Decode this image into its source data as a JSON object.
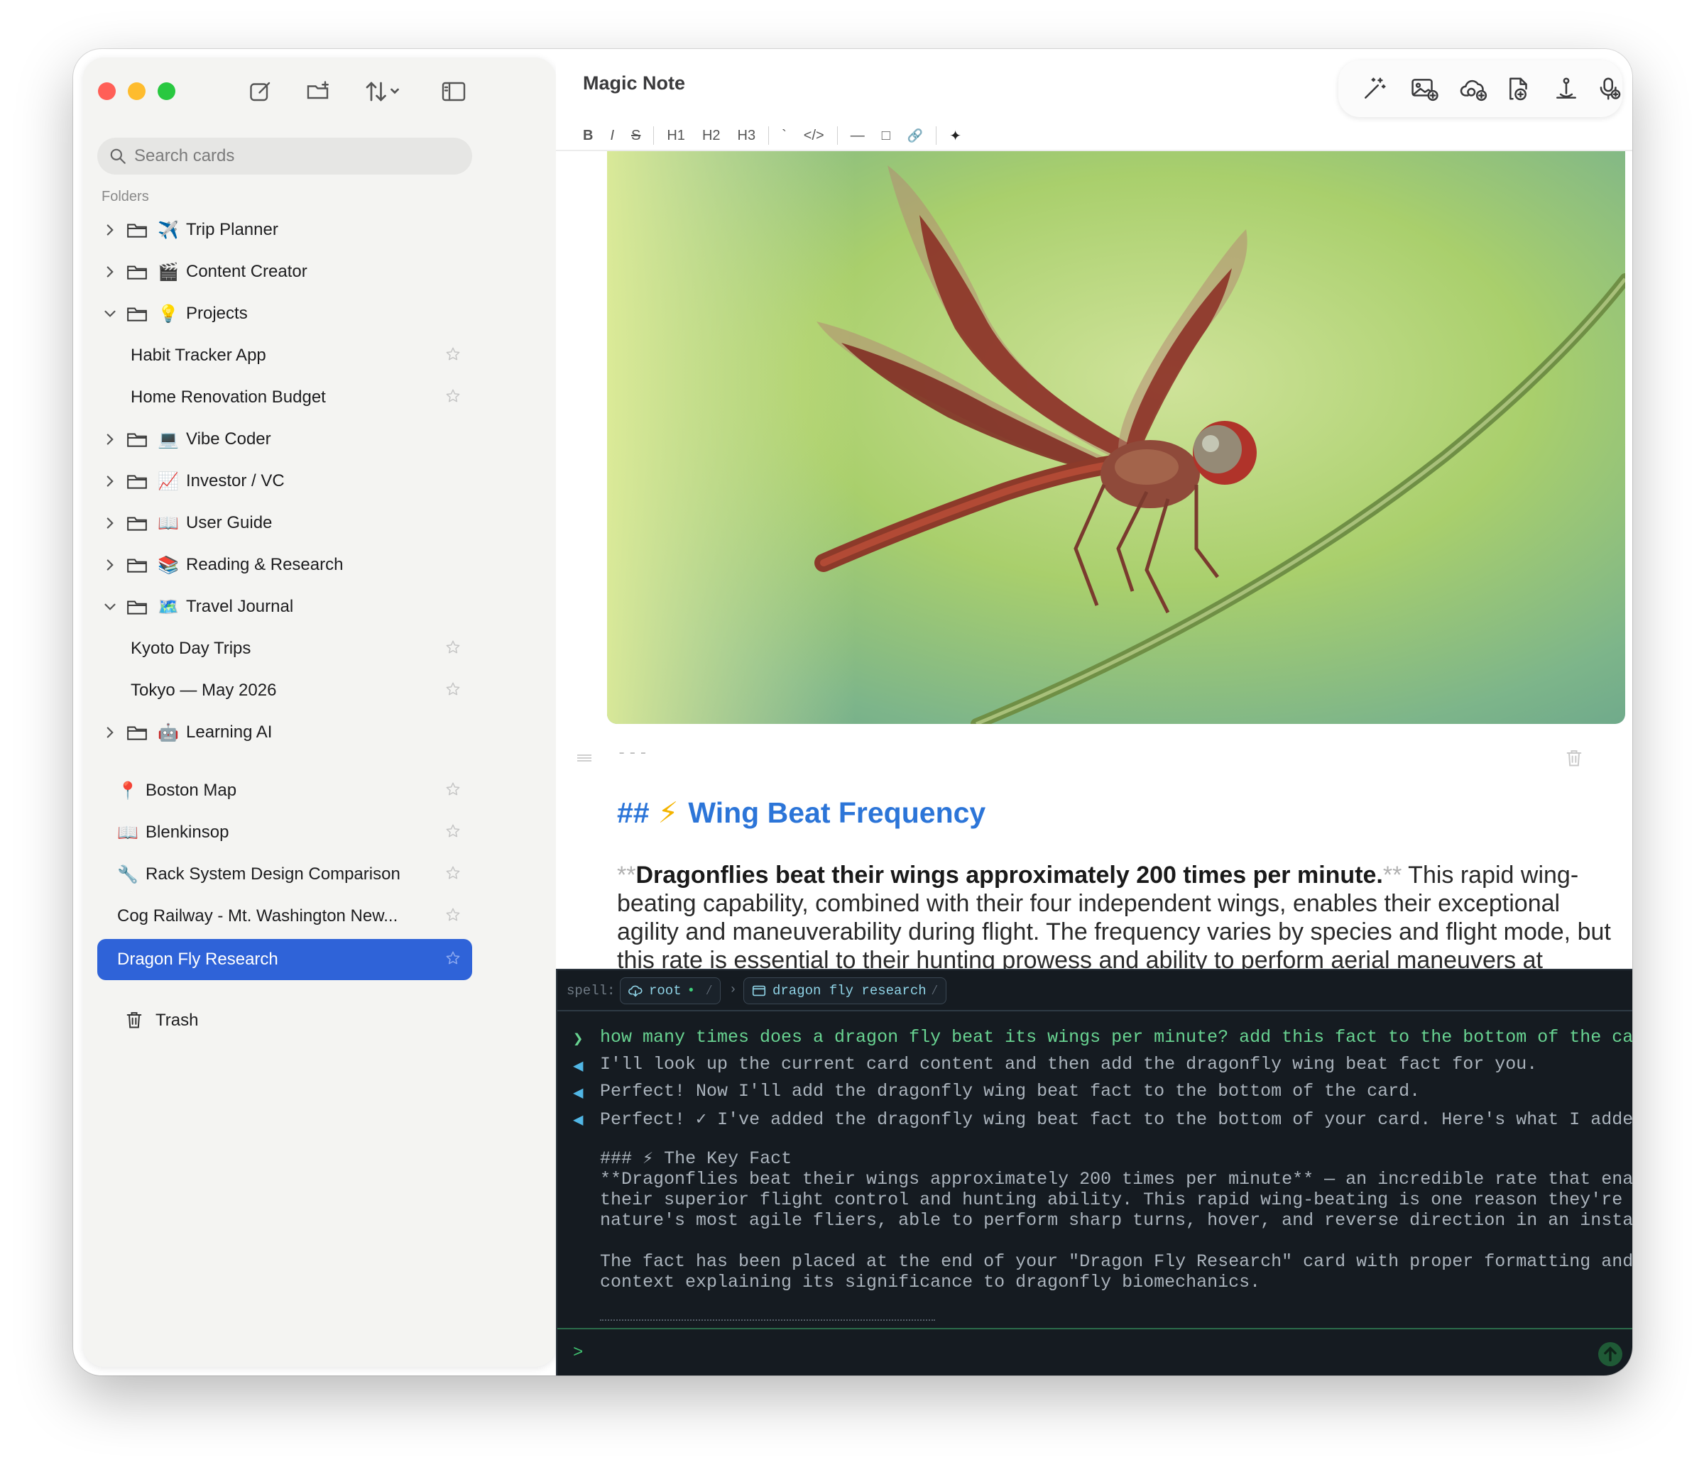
{
  "app": {
    "title": "Magic Note"
  },
  "search": {
    "placeholder": "Search cards"
  },
  "sidebar": {
    "folders_label": "Folders",
    "folders": [
      {
        "emoji": "✈️",
        "label": "Trip Planner",
        "expanded": false
      },
      {
        "emoji": "🎬",
        "label": "Content Creator",
        "expanded": false
      },
      {
        "emoji": "💡",
        "label": "Projects",
        "expanded": true,
        "children": [
          {
            "label": "Habit Tracker App"
          },
          {
            "label": "Home Renovation Budget"
          }
        ]
      },
      {
        "emoji": "💻",
        "label": "Vibe Coder",
        "expanded": false
      },
      {
        "emoji": "📈",
        "label": "Investor / VC",
        "expanded": false
      },
      {
        "emoji": "📖",
        "label": "User Guide",
        "expanded": false
      },
      {
        "emoji": "📚",
        "label": "Reading & Research",
        "expanded": false
      },
      {
        "emoji": "🗺️",
        "label": "Travel Journal",
        "expanded": true,
        "children": [
          {
            "label": "Kyoto Day Trips"
          },
          {
            "label": "Tokyo — May 2026"
          }
        ]
      },
      {
        "emoji": "🤖",
        "label": "Learning AI",
        "expanded": false
      }
    ],
    "cards": [
      {
        "emoji": "📍",
        "label": "Boston Map"
      },
      {
        "emoji": "📖",
        "label": "Blenkinsop"
      },
      {
        "emoji": "🔧",
        "label": "Rack System Design Comparison"
      },
      {
        "emoji": "",
        "label": "Cog Railway - Mt. Washington New..."
      },
      {
        "emoji": "",
        "label": "Dragon Fly Research",
        "selected": true
      }
    ],
    "trash_label": "Trash"
  },
  "toolbar": {
    "format_buttons": [
      "B",
      "I",
      "S",
      "H1",
      "H2",
      "H3",
      "`",
      "</>",
      "—",
      "□",
      "🔗",
      "✦"
    ],
    "actions": [
      "magic-wand-icon",
      "add-image-icon",
      "ai-cloud-icon",
      "new-file-icon",
      "anchor-icon",
      "mic-icon"
    ]
  },
  "editor": {
    "hr_markdown": "---",
    "heading_mark": "##",
    "heading_emoji": "⚡",
    "heading_text": "Wing Beat Frequency",
    "para_stars_open": "**",
    "para_bold": "Dragonflies beat their wings approximately 200 times per minute.",
    "para_stars_close": "**",
    "para_rest": " This rapid wing-beating capability, combined with their four independent wings, enables their exceptional agility and maneuverability during flight. The frequency varies by species and flight mode, but this rate is essential to their hunting prowess and ability to perform aerial maneuvers at"
  },
  "terminal": {
    "spell_label": "spell:",
    "root_chip": "root",
    "card_chip": "dragon fly research",
    "user_indicator": "❯",
    "assistant_indicator": "◀",
    "messages": [
      {
        "role": "user",
        "text": "how many times does a dragon fly beat its wings per minute? add this fact to the bottom of the card"
      },
      {
        "role": "assistant",
        "text": "I'll look up the current card content and then add the dragonfly wing beat fact for you."
      },
      {
        "role": "assistant",
        "text": "Perfect! Now I'll add the dragonfly wing beat fact to the bottom of the card."
      },
      {
        "role": "assistant",
        "text": "Perfect! ✓ I've added the dragonfly wing beat fact to the bottom of your card. Here's what I added:"
      }
    ],
    "output_lines": [
      "### ⚡ The Key Fact",
      "**Dragonflies beat their wings approximately 200 times per minute** — an incredible rate that enables",
      "their superior flight control and hunting ability. This rapid wing-beating is one reason they're among",
      "nature's most agile fliers, able to perform sharp turns, hover, and reverse direction in an instant.",
      "",
      "The fact has been placed at the end of your \"Dragon Fly Research\" card with proper formatting and",
      "context explaining its significance to dragonfly biomechanics."
    ],
    "prompt_symbol": ">"
  },
  "colors": {
    "accent": "#2f63d8",
    "heading": "#2c75d8",
    "terminal_bg": "#151b21",
    "terminal_user": "#68d391",
    "terminal_assistant_indicator": "#51b7e6"
  }
}
